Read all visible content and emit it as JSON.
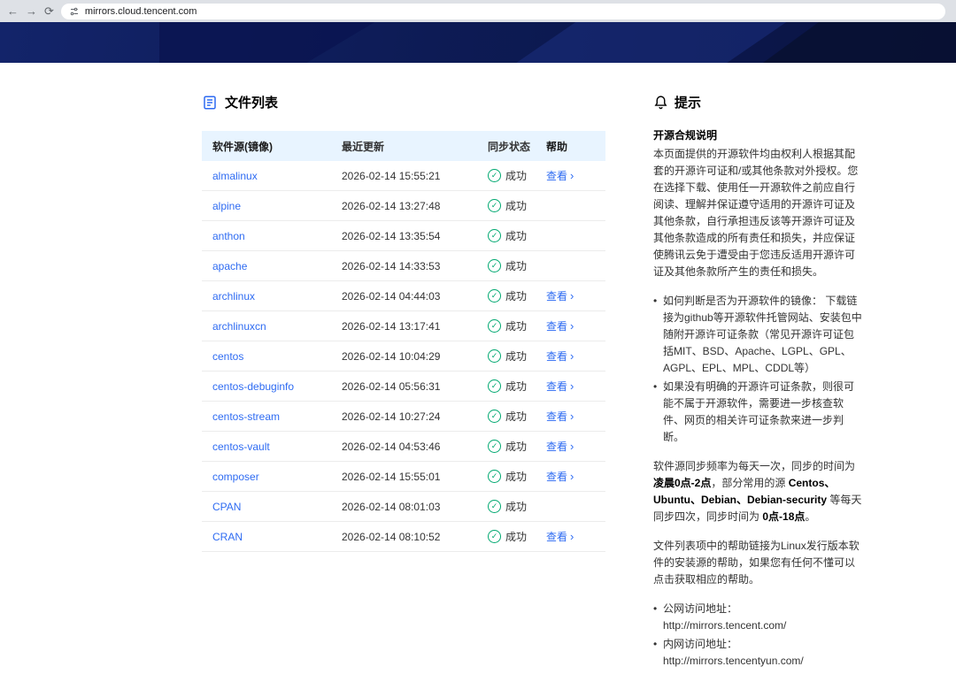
{
  "colors": {
    "accent": "#2e6bf2",
    "success": "#00a870",
    "header-bg": "#e8f4ff",
    "banner": "#0d1b55"
  },
  "browser": {
    "url": "mirrors.cloud.tencent.com"
  },
  "file_list": {
    "title": "文件列表",
    "columns": [
      "软件源(镜像)",
      "最近更新",
      "同步状态",
      "帮助"
    ],
    "status_success": "成功",
    "help_label": "查看",
    "rows": [
      {
        "name": "almalinux",
        "updated": "2026-02-14 15:55:21",
        "help": true
      },
      {
        "name": "alpine",
        "updated": "2026-02-14 13:27:48",
        "help": false
      },
      {
        "name": "anthon",
        "updated": "2026-02-14 13:35:54",
        "help": false
      },
      {
        "name": "apache",
        "updated": "2026-02-14 14:33:53",
        "help": false
      },
      {
        "name": "archlinux",
        "updated": "2026-02-14 04:44:03",
        "help": true
      },
      {
        "name": "archlinuxcn",
        "updated": "2026-02-14 13:17:41",
        "help": true
      },
      {
        "name": "centos",
        "updated": "2026-02-14 10:04:29",
        "help": true
      },
      {
        "name": "centos-debuginfo",
        "updated": "2026-02-14 05:56:31",
        "help": true
      },
      {
        "name": "centos-stream",
        "updated": "2026-02-14 10:27:24",
        "help": true
      },
      {
        "name": "centos-vault",
        "updated": "2026-02-14 04:53:46",
        "help": true
      },
      {
        "name": "composer",
        "updated": "2026-02-14 15:55:01",
        "help": true
      },
      {
        "name": "CPAN",
        "updated": "2026-02-14 08:01:03",
        "help": false
      },
      {
        "name": "CRAN",
        "updated": "2026-02-14 08:10:52",
        "help": true
      }
    ]
  },
  "tips": {
    "title": "提示",
    "blocks": [
      {
        "type": "heading",
        "text": "开源合规说明"
      },
      {
        "type": "paragraph",
        "segments": [
          {
            "t": "本页面提供的开源软件均由权利人根据其配套的开源许可证和/或其他条款对外授权。您在选择下载、使用任一开源软件之前应自行阅读、理解并保证遵守适用的开源许可证及其他条款，自行承担违反该等开源许可证及其他条款造成的所有责任和损失，并应保证使腾讯云免于遭受由于您违反适用开源许可证及其他条款所产生的责任和损失。"
          }
        ]
      },
      {
        "type": "bullets",
        "items": [
          [
            {
              "t": "如何判断是否为开源软件的镜像： 下载链接为github等开源软件托管网站、安装包中随附开源许可证条款（常见开源许可证包括MIT、BSD、Apache、LGPL、GPL、AGPL、EPL、MPL、CDDL等）"
            }
          ],
          [
            {
              "t": "如果没有明确的开源许可证条款，则很可能不属于开源软件，需要进一步核查软件、网页的相关许可证条款来进一步判断。"
            }
          ]
        ]
      },
      {
        "type": "paragraph",
        "segments": [
          {
            "t": "软件源同步频率为每天一次，同步的时间为"
          },
          {
            "t": "凌晨0点-2点",
            "b": true
          },
          {
            "t": "，部分常用的源 "
          },
          {
            "t": "Centos、Ubuntu、Debian、Debian-security",
            "b": true
          },
          {
            "t": " 等每天同步四次，同步时间为 "
          },
          {
            "t": "0点-18点",
            "b": true
          },
          {
            "t": "。"
          }
        ]
      },
      {
        "type": "paragraph",
        "segments": [
          {
            "t": "文件列表项中的帮助链接为Linux发行版本软件的安装源的帮助，如果您有任何不懂可以点击获取相应的帮助。"
          }
        ]
      },
      {
        "type": "bullets",
        "items": [
          [
            {
              "t": "公网访问地址："
            },
            {
              "t": "http://mirrors.tencent.com/",
              "br": true
            }
          ],
          [
            {
              "t": "内网访问地址："
            },
            {
              "t": "http://mirrors.tencentyun.com/",
              "br": true
            }
          ]
        ]
      }
    ]
  }
}
